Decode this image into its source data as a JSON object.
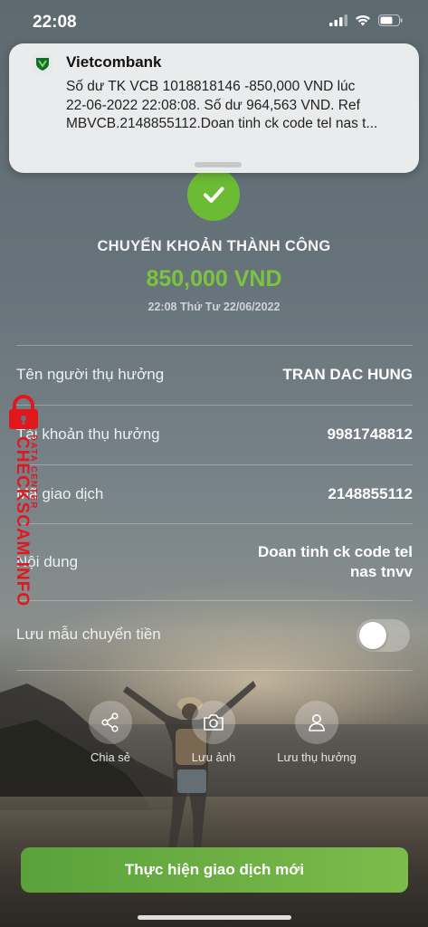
{
  "status_bar": {
    "time": "22:08"
  },
  "notification": {
    "app_name": "Vietcombank",
    "lines": [
      "Số dư TK VCB 1018818146 -850,000 VND lúc",
      "22-06-2022 22:08:08. Số dư 964,563 VND. Ref",
      "MBVCB.2148855112.Doan tinh ck code tel nas t..."
    ]
  },
  "result": {
    "title": "CHUYỂN KHOẢN THÀNH CÔNG",
    "amount": "850,000 VND",
    "datetime": "22:08 Thứ Tư 22/06/2022"
  },
  "details": {
    "beneficiary_name_label": "Tên người thụ hưởng",
    "beneficiary_name_value": "TRAN DAC HUNG",
    "beneficiary_account_label": "Tài khoản thụ hưởng",
    "beneficiary_account_value": "9981748812",
    "transaction_id_label": "Mã giao dịch",
    "transaction_id_value": "2148855112",
    "content_label": "Nội dung",
    "content_value_line1": "Doan tinh ck code tel",
    "content_value_line2": "nas tnvv"
  },
  "save_template": {
    "label": "Lưu mẫu chuyển tiền",
    "enabled": false
  },
  "actions": {
    "share_label": "Chia sẻ",
    "save_image_label": "Lưu ảnh",
    "save_beneficiary_label": "Lưu thụ hưởng"
  },
  "primary_button": {
    "label": "Thực hiện giao dịch mới"
  },
  "watermark": {
    "main": "CHECKSCAM.INFO",
    "sub": "DATA CENTER"
  },
  "colors": {
    "accent_green": "#7cc440",
    "success_green": "#6cbb35",
    "watermark_red": "#e0181e"
  },
  "icons": [
    "signal-icon",
    "wifi-icon",
    "battery-icon",
    "vietcombank-logo-icon",
    "checkmark-icon",
    "share-icon",
    "camera-icon",
    "person-icon",
    "lock-icon"
  ]
}
